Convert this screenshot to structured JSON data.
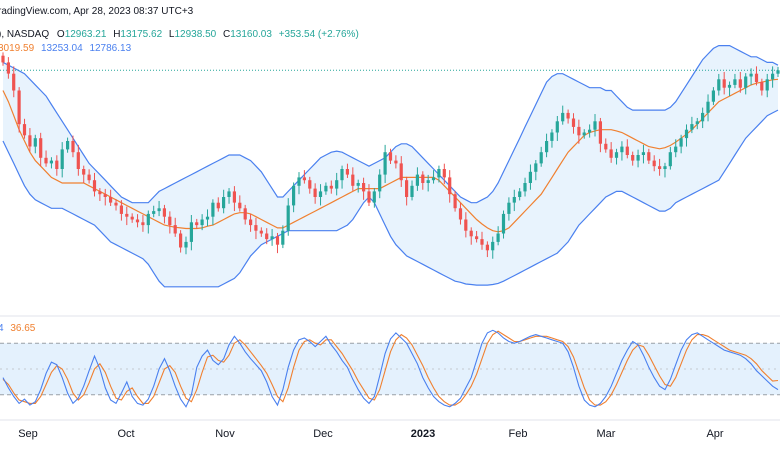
{
  "header": {
    "watermark_line": "radingView.com, Apr 28, 2023 08:37 UTC+3",
    "symbol_exchange": "), NASDAQ",
    "ohlc": {
      "o_label": "O",
      "o_value": "12963.21",
      "h_label": "H",
      "h_value": "13175.62",
      "l_label": "L",
      "l_value": "12938.50",
      "c_label": "C",
      "c_value": "13160.03",
      "change": "+353.54 (+2.76%)"
    },
    "bb_values": {
      "basis": "3019.59",
      "upper": "13253.04",
      "lower": "12786.13"
    }
  },
  "stoch_header": {
    "k_value": "4",
    "d_value": "36.65"
  },
  "x_axis": {
    "labels": [
      "Sep",
      "Oct",
      "Nov",
      "Dec",
      "2023",
      "Feb",
      "Mar",
      "Apr"
    ]
  },
  "colors": {
    "up": "#26a69a",
    "down": "#ef5350",
    "bb_band": "#4a80ef",
    "bb_basis": "#f08030",
    "bb_fill": "#e8f3fd",
    "stoch_k": "#4a80ef",
    "stoch_d": "#f08030",
    "stoch_fill": "#e4f1fd",
    "last_price_line": "#26a69a"
  },
  "chart_data": [
    {
      "type": "candlestick",
      "name": "price",
      "overlays": [
        "Bollinger Bands (basis, upper, lower)"
      ],
      "close": [
        13300,
        13100,
        12800,
        12200,
        12000,
        11800,
        11950,
        11600,
        11500,
        11550,
        11400,
        11750,
        11900,
        11700,
        11400,
        11300,
        11200,
        11000,
        10950,
        10900,
        10800,
        10750,
        10600,
        10550,
        10500,
        10450,
        10400,
        10600,
        10650,
        10700,
        10550,
        10400,
        10250,
        10000,
        10100,
        10450,
        10400,
        10500,
        10550,
        10800,
        10700,
        10900,
        11000,
        10800,
        10700,
        10500,
        10400,
        10300,
        10250,
        10150,
        10200,
        10050,
        10300,
        10750,
        11100,
        11250,
        11200,
        11050,
        10900,
        11000,
        11100,
        11050,
        11200,
        11400,
        11300,
        11100,
        11150,
        11000,
        10800,
        11000,
        11300,
        11700,
        11550,
        11500,
        11200,
        10900,
        11100,
        11300,
        11150,
        11200,
        11250,
        11400,
        11250,
        10950,
        10700,
        10500,
        10300,
        10200,
        10150,
        10050,
        9950,
        10100,
        10250,
        10600,
        10800,
        10900,
        11000,
        11150,
        11350,
        11500,
        11700,
        11900,
        12050,
        12250,
        12400,
        12300,
        12150,
        12000,
        12050,
        12100,
        12250,
        11850,
        11750,
        11600,
        11700,
        11800,
        11650,
        11550,
        11650,
        11700,
        11550,
        11450,
        11400,
        11450,
        11700,
        11800,
        11950,
        12100,
        12200,
        12250,
        12400,
        12600,
        12800,
        13000,
        12850,
        12900,
        13000,
        12850,
        13050,
        13100,
        12950,
        12800,
        13000,
        13100,
        13160
      ],
      "bb_upper": [
        13300,
        13250,
        13200,
        13150,
        13100,
        13000,
        12900,
        12800,
        12700,
        12550,
        12400,
        12250,
        12100,
        11950,
        11800,
        11650,
        11500,
        11400,
        11300,
        11200,
        11100,
        11000,
        10900,
        10850,
        10800,
        10800,
        10800,
        10800,
        10900,
        11000,
        11050,
        11100,
        11150,
        11200,
        11250,
        11300,
        11350,
        11400,
        11450,
        11500,
        11550,
        11600,
        11650,
        11650,
        11650,
        11600,
        11550,
        11450,
        11350,
        11200,
        11050,
        10900,
        10900,
        11000,
        11100,
        11200,
        11300,
        11400,
        11500,
        11600,
        11650,
        11700,
        11720,
        11700,
        11650,
        11600,
        11550,
        11500,
        11450,
        11500,
        11550,
        11600,
        11700,
        11800,
        11850,
        11850,
        11800,
        11700,
        11600,
        11500,
        11400,
        11300,
        11200,
        11100,
        11000,
        10900,
        10850,
        10800,
        10800,
        10850,
        10900,
        11000,
        11150,
        11350,
        11550,
        11750,
        11950,
        12150,
        12350,
        12550,
        12750,
        12950,
        13050,
        13100,
        13100,
        13050,
        13000,
        12950,
        12900,
        12850,
        12850,
        12850,
        12800,
        12800,
        12700,
        12600,
        12500,
        12450,
        12450,
        12450,
        12450,
        12450,
        12450,
        12450,
        12500,
        12600,
        12750,
        12900,
        13050,
        13200,
        13350,
        13450,
        13550,
        13600,
        13600,
        13600,
        13550,
        13500,
        13450,
        13400,
        13400,
        13350,
        13300,
        13300,
        13250
      ],
      "bb_basis": [
        12800,
        12600,
        12350,
        12100,
        11900,
        11700,
        11550,
        11450,
        11350,
        11250,
        11200,
        11150,
        11150,
        11150,
        11150,
        11150,
        11100,
        11050,
        11000,
        10950,
        10900,
        10850,
        10800,
        10750,
        10700,
        10650,
        10600,
        10550,
        10500,
        10450,
        10400,
        10380,
        10360,
        10350,
        10340,
        10340,
        10340,
        10350,
        10380,
        10400,
        10450,
        10500,
        10550,
        10600,
        10620,
        10620,
        10600,
        10550,
        10500,
        10450,
        10400,
        10350,
        10350,
        10400,
        10450,
        10500,
        10550,
        10600,
        10650,
        10700,
        10750,
        10800,
        10850,
        10900,
        10950,
        11000,
        11050,
        11050,
        11050,
        11050,
        11050,
        11100,
        11150,
        11200,
        11250,
        11250,
        11250,
        11250,
        11250,
        11250,
        11250,
        11200,
        11100,
        11000,
        10900,
        10800,
        10700,
        10600,
        10500,
        10420,
        10350,
        10300,
        10280,
        10300,
        10350,
        10450,
        10550,
        10650,
        10750,
        10850,
        10950,
        11100,
        11250,
        11400,
        11550,
        11700,
        11800,
        11900,
        12000,
        12050,
        12080,
        12100,
        12100,
        12100,
        12080,
        12050,
        12000,
        11950,
        11900,
        11850,
        11800,
        11780,
        11760,
        11780,
        11820,
        11880,
        11950,
        12020,
        12100,
        12200,
        12300,
        12400,
        12500,
        12600,
        12650,
        12700,
        12750,
        12800,
        12850,
        12900,
        12930,
        12950,
        12970,
        12990,
        13000
      ],
      "bb_lower": [
        11900,
        11700,
        11500,
        11300,
        11100,
        10950,
        10850,
        10800,
        10750,
        10700,
        10700,
        10700,
        10650,
        10600,
        10550,
        10500,
        10450,
        10400,
        10300,
        10200,
        10100,
        10050,
        10000,
        9950,
        9900,
        9850,
        9800,
        9700,
        9550,
        9400,
        9300,
        9300,
        9300,
        9300,
        9300,
        9300,
        9300,
        9300,
        9300,
        9300,
        9300,
        9350,
        9400,
        9450,
        9550,
        9700,
        9850,
        9950,
        10050,
        10100,
        10150,
        10200,
        10250,
        10300,
        10300,
        10300,
        10300,
        10300,
        10300,
        10300,
        10300,
        10300,
        10300,
        10350,
        10400,
        10500,
        10650,
        10800,
        10900,
        10800,
        10600,
        10400,
        10200,
        10050,
        9950,
        9850,
        9800,
        9750,
        9700,
        9650,
        9600,
        9550,
        9500,
        9450,
        9400,
        9380,
        9350,
        9340,
        9330,
        9330,
        9330,
        9340,
        9360,
        9400,
        9450,
        9500,
        9550,
        9600,
        9650,
        9700,
        9750,
        9800,
        9850,
        9900,
        10000,
        10100,
        10250,
        10400,
        10500,
        10600,
        10700,
        10800,
        10900,
        10950,
        11000,
        11000,
        10950,
        10900,
        10850,
        10800,
        10750,
        10700,
        10650,
        10650,
        10700,
        10800,
        10850,
        10900,
        10950,
        11000,
        11050,
        11100,
        11150,
        11200,
        11350,
        11500,
        11650,
        11800,
        11950,
        12050,
        12150,
        12250,
        12350,
        12400,
        12450
      ],
      "last_price": 13160.03
    },
    {
      "type": "line",
      "name": "stochastic",
      "ylim": [
        0,
        100
      ],
      "levels": [
        80,
        20
      ],
      "k": [
        40,
        28,
        18,
        10,
        15,
        8,
        12,
        26,
        45,
        58,
        55,
        40,
        22,
        10,
        16,
        30,
        48,
        65,
        50,
        28,
        14,
        10,
        22,
        35,
        18,
        10,
        8,
        15,
        30,
        50,
        62,
        48,
        30,
        15,
        6,
        20,
        52,
        65,
        72,
        60,
        55,
        62,
        78,
        88,
        80,
        70,
        62,
        55,
        48,
        35,
        18,
        8,
        26,
        52,
        72,
        84,
        86,
        82,
        76,
        82,
        88,
        78,
        70,
        60,
        52,
        38,
        26,
        16,
        10,
        18,
        42,
        68,
        85,
        92,
        86,
        80,
        68,
        56,
        40,
        28,
        18,
        12,
        8,
        6,
        10,
        16,
        28,
        40,
        60,
        80,
        92,
        95,
        92,
        86,
        82,
        80,
        82,
        85,
        88,
        90,
        88,
        86,
        84,
        82,
        80,
        70,
        52,
        30,
        14,
        8,
        6,
        10,
        18,
        30,
        45,
        60,
        72,
        82,
        78,
        66,
        52,
        40,
        30,
        26,
        38,
        55,
        72,
        84,
        90,
        92,
        88,
        84,
        80,
        76,
        72,
        70,
        68,
        66,
        62,
        56,
        48,
        42,
        36,
        30,
        26
      ],
      "d": [
        38,
        32,
        22,
        14,
        12,
        10,
        10,
        18,
        32,
        46,
        54,
        50,
        38,
        22,
        14,
        20,
        34,
        50,
        56,
        46,
        30,
        16,
        14,
        24,
        28,
        18,
        10,
        10,
        18,
        34,
        50,
        54,
        46,
        30,
        16,
        12,
        26,
        46,
        64,
        66,
        60,
        58,
        66,
        80,
        84,
        78,
        70,
        62,
        54,
        45,
        32,
        18,
        12,
        28,
        52,
        72,
        82,
        84,
        80,
        78,
        84,
        84,
        76,
        68,
        58,
        48,
        36,
        26,
        16,
        14,
        26,
        48,
        70,
        84,
        90,
        86,
        78,
        66,
        54,
        40,
        28,
        18,
        12,
        8,
        8,
        12,
        20,
        30,
        44,
        62,
        80,
        90,
        94,
        90,
        86,
        82,
        82,
        84,
        86,
        88,
        88,
        88,
        86,
        84,
        82,
        76,
        64,
        46,
        28,
        14,
        8,
        8,
        12,
        20,
        32,
        46,
        60,
        72,
        78,
        76,
        66,
        54,
        42,
        32,
        30,
        40,
        56,
        72,
        84,
        90,
        90,
        88,
        84,
        80,
        76,
        72,
        70,
        68,
        66,
        62,
        56,
        48,
        42,
        36,
        36.65
      ]
    }
  ]
}
